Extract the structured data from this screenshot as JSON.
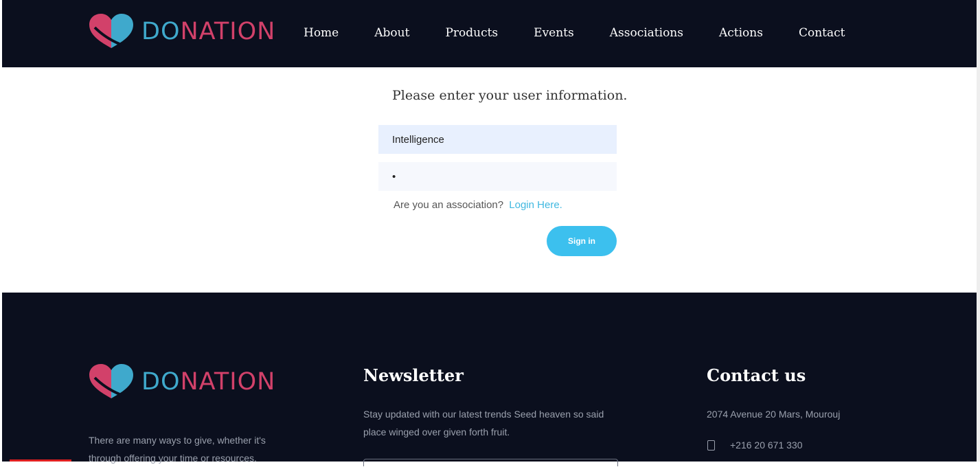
{
  "brand": {
    "logo_do": "DO",
    "logo_nation": "NATION",
    "color_blue": "#3fa9cc",
    "color_pink": "#d2416a"
  },
  "nav": {
    "items": [
      "Home",
      "About",
      "Products",
      "Events",
      "Associations",
      "Actions",
      "Contact"
    ]
  },
  "login": {
    "prompt": "Please enter your user information.",
    "username_value": "Intelligence",
    "password_value": "•",
    "association_question": "Are you an association?",
    "association_link": "Login Here.",
    "signin_label": "Sign in"
  },
  "footer": {
    "about_text": "There are many ways to give, whether it's through offering your time or resources.",
    "newsletter_title": "Newsletter",
    "newsletter_text": "Stay updated with our latest trends Seed heaven so said place winged over given forth fruit.",
    "contact_title": "Contact us",
    "address": "2074 Avenue 20 Mars, Mourouj",
    "phone": "+216 20 671 330"
  }
}
